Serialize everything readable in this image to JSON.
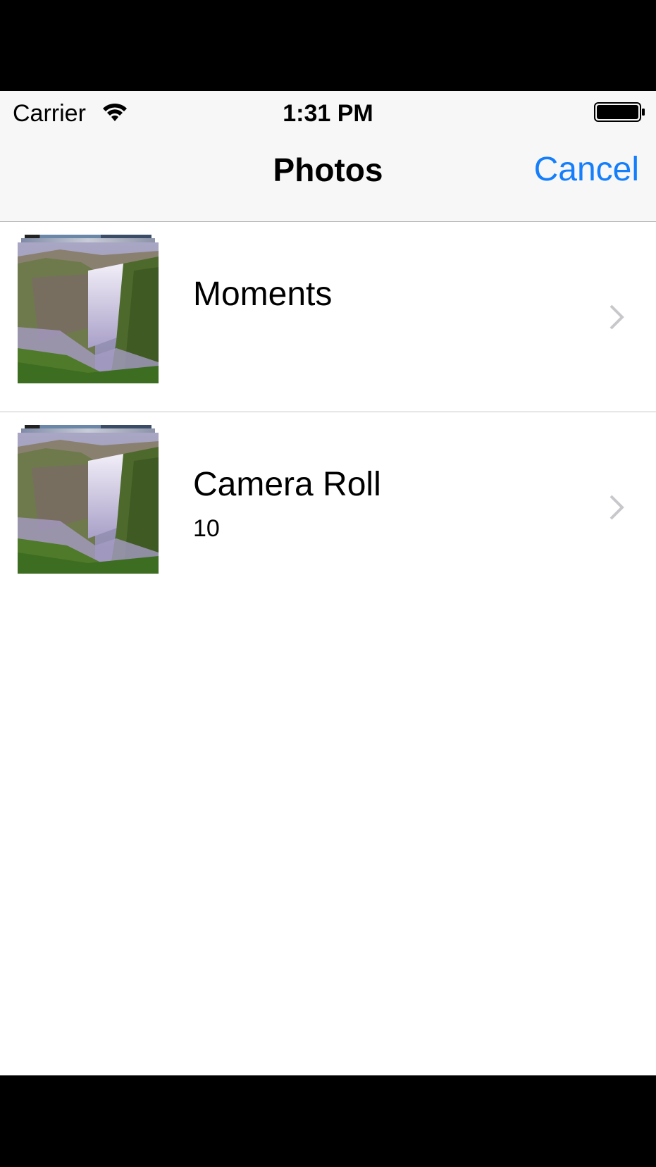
{
  "status_bar": {
    "carrier": "Carrier",
    "time": "1:31 PM",
    "icons": [
      "wifi-icon",
      "battery-icon"
    ]
  },
  "nav_bar": {
    "title": "Photos",
    "cancel_label": "Cancel",
    "accent_color": "#147EFB"
  },
  "albums": [
    {
      "title": "Moments",
      "count": ""
    },
    {
      "title": "Camera Roll",
      "count": "10"
    }
  ],
  "colors": {
    "nav_background": "#F7F7F7",
    "separator": "#C8C7CC",
    "chevron": "#C7C7CC"
  }
}
